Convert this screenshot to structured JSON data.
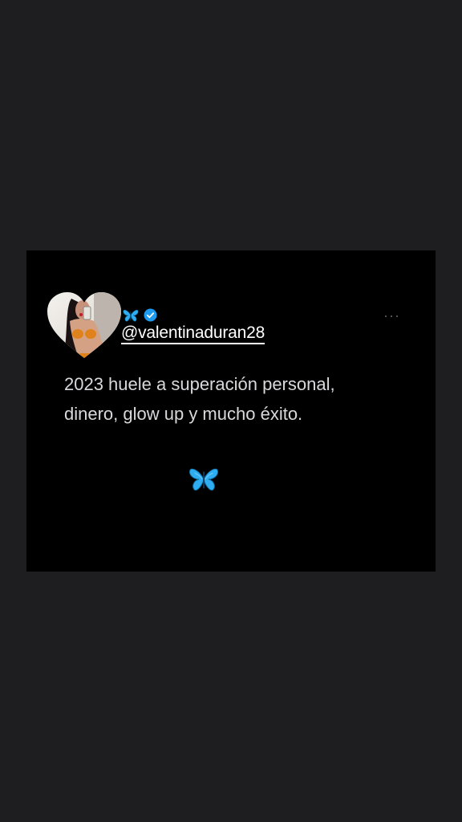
{
  "tweet": {
    "handle": "@valentinaduran28",
    "text": "2023 huele a superación personal,\ndinero, glow up y mucho éxito.",
    "name_badges": [
      "butterfly-icon",
      "verified-badge-icon"
    ],
    "more_label": "···",
    "footer_icon": "butterfly-icon"
  },
  "colors": {
    "page_background": "#1e1e20",
    "card_background": "#000000",
    "text": "#d9d9dc",
    "handle": "#ffffff",
    "verified": "#1d9bf0",
    "butterfly": "#2eaef0"
  }
}
